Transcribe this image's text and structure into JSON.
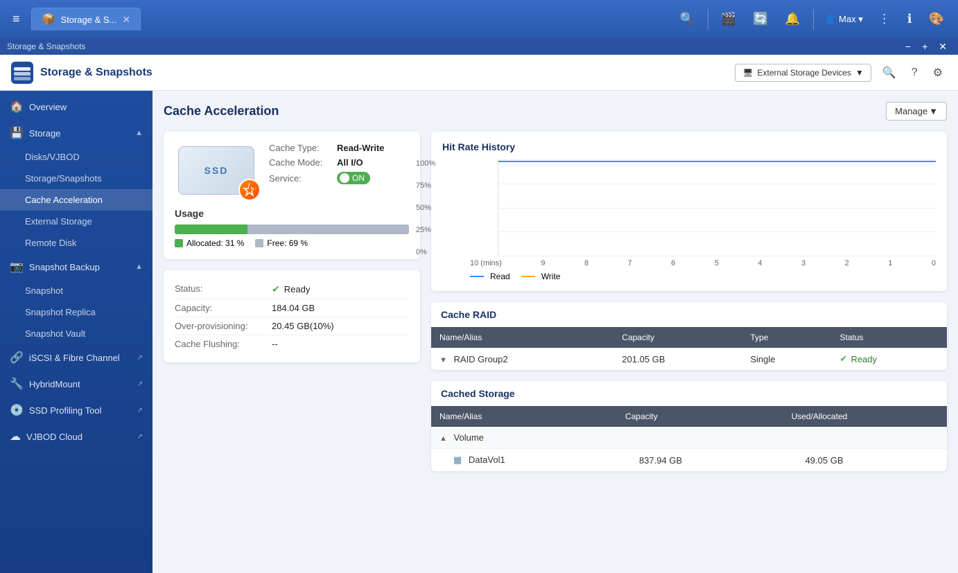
{
  "titleBar": {
    "tabLabel": "Storage & S...",
    "menuBtn": "≡",
    "icons": [
      "🔍",
      "🎬",
      "🔄",
      "🔔"
    ],
    "userName": "Max ▾",
    "windowControls": {
      "minimize": "−",
      "maximize": "+",
      "close": "✕"
    }
  },
  "appBar": {
    "title": "Storage & Snapshots",
    "controls": {
      "minimize": "−",
      "maximize": "+",
      "close": "✕"
    }
  },
  "mainHeader": {
    "appTitle": "Storage & Snapshots",
    "extStorageBtn": "External Storage Devices",
    "icons": [
      "🔍",
      "?",
      "⚙"
    ]
  },
  "sidebar": {
    "items": [
      {
        "id": "overview",
        "label": "Overview",
        "icon": "🏠",
        "level": 0,
        "hasArrow": false
      },
      {
        "id": "storage",
        "label": "Storage",
        "icon": "💾",
        "level": 0,
        "hasArrow": true,
        "expanded": true
      },
      {
        "id": "disks",
        "label": "Disks/VJBOD",
        "level": 1
      },
      {
        "id": "storage-snapshots",
        "label": "Storage/Snapshots",
        "level": 1
      },
      {
        "id": "cache-acceleration",
        "label": "Cache Acceleration",
        "level": 1,
        "active": true
      },
      {
        "id": "external-storage",
        "label": "External Storage",
        "level": 1
      },
      {
        "id": "remote-disk",
        "label": "Remote Disk",
        "level": 1
      },
      {
        "id": "snapshot-backup",
        "label": "Snapshot Backup",
        "icon": "📷",
        "level": 0,
        "hasArrow": true,
        "expanded": true
      },
      {
        "id": "snapshot",
        "label": "Snapshot",
        "level": 1
      },
      {
        "id": "snapshot-replica",
        "label": "Snapshot Replica",
        "level": 1
      },
      {
        "id": "snapshot-vault",
        "label": "Snapshot Vault",
        "level": 1
      },
      {
        "id": "iscsi",
        "label": "iSCSI & Fibre Channel",
        "icon": "🔗",
        "level": 0,
        "external": true
      },
      {
        "id": "hybridmount",
        "label": "HybridMount",
        "icon": "🔧",
        "level": 0,
        "external": true
      },
      {
        "id": "ssd-profiling",
        "label": "SSD Profiling Tool",
        "icon": "💿",
        "level": 0,
        "external": true
      },
      {
        "id": "vjbod-cloud",
        "label": "VJBOD Cloud",
        "icon": "☁",
        "level": 0,
        "external": true
      }
    ]
  },
  "content": {
    "pageTitle": "Cache Acceleration",
    "manageBtn": "Manage",
    "ssd": {
      "label": "SSD",
      "cacheType": {
        "label": "Cache Type:",
        "value": "Read-Write"
      },
      "cacheMode": {
        "label": "Cache Mode:",
        "value": "All I/O"
      },
      "service": {
        "label": "Service:",
        "toggleText": "ON"
      }
    },
    "usage": {
      "title": "Usage",
      "allocatedPct": 31,
      "freePct": 69,
      "allocatedLabel": "Allocated: 31 %",
      "freeLabel": "Free: 69 %"
    },
    "statusDetail": {
      "rows": [
        {
          "key": "Status:",
          "value": "Ready",
          "isStatus": true
        },
        {
          "key": "Capacity:",
          "value": "184.04 GB"
        },
        {
          "key": "Over-provisioning:",
          "value": "20.45 GB(10%)"
        },
        {
          "key": "Cache Flushing:",
          "value": "--"
        }
      ]
    },
    "hitRateChart": {
      "title": "Hit Rate History",
      "yLabels": [
        "100%",
        "75%",
        "50%",
        "25%",
        "0%"
      ],
      "xLabels": [
        "10 (mins)",
        "9",
        "8",
        "7",
        "6",
        "5",
        "4",
        "3",
        "2",
        "1",
        "0"
      ],
      "legend": [
        {
          "color": "#4488ff",
          "label": "Read"
        },
        {
          "color": "#ffaa33",
          "label": "Write"
        }
      ]
    },
    "cacheRaid": {
      "title": "Cache RAID",
      "columns": [
        "Name/Alias",
        "Capacity",
        "Type",
        "Status"
      ],
      "rows": [
        {
          "name": "RAID Group2",
          "capacity": "201.05 GB",
          "type": "Single",
          "status": "Ready",
          "expandable": true
        }
      ]
    },
    "cachedStorage": {
      "title": "Cached Storage",
      "columns": [
        "Name/Alias",
        "Capacity",
        "Used/Allocated"
      ],
      "groups": [
        {
          "groupName": "Volume",
          "items": [
            {
              "name": "DataVol1",
              "capacity": "837.94 GB",
              "usedAllocated": "49.05 GB"
            }
          ]
        }
      ]
    }
  }
}
